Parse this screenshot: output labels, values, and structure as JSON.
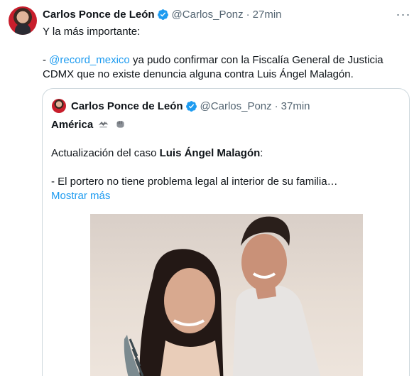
{
  "tweet": {
    "author_name": "Carlos Ponce de León",
    "author_handle": "@Carlos_Ponz",
    "separator": "·",
    "time": "27min",
    "more_label": "···",
    "line1": "Y la más importante:",
    "line2_prefix": "- ",
    "mention": "@record_mexico",
    "line2_rest": " ya pudo confirmar con la Fiscalía General de Justicia",
    "line3": "CDMX que no existe denuncia alguna contra Luis Ángel Malagón."
  },
  "quote": {
    "author_name": "Carlos Ponce de León",
    "author_handle": "@Carlos_Ponz",
    "separator": "·",
    "time": "37min",
    "line1": "América",
    "line2_prefix": "Actualización del caso ",
    "line2_bold": "Luis Ángel Malagón",
    "line2_suffix": ":",
    "line3": "- El portero no tiene problema legal al interior de su familia…",
    "show_more": "Mostrar más",
    "emojis": [
      "eagle-icon",
      "fist-icon"
    ]
  },
  "colors": {
    "link": "#1d9bf0",
    "verified": "#1d9bf0",
    "secondary_text": "#536471",
    "border": "#cfd9de"
  }
}
